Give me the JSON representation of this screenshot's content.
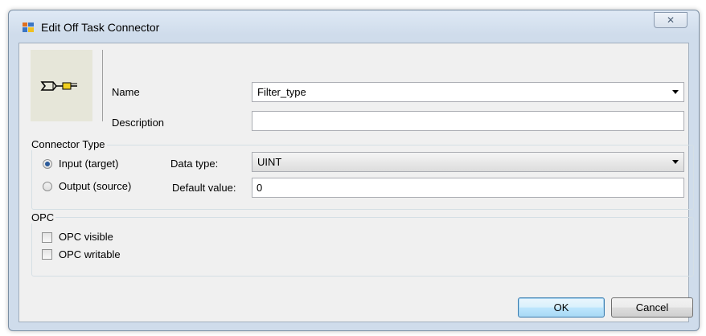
{
  "window": {
    "title": "Edit Off Task Connector",
    "close_glyph": "✕"
  },
  "icons": {
    "app": "dialog-app-icon",
    "connector": "off-task-connector-icon"
  },
  "general": {
    "name_label": "Name",
    "name_value": "Filter_type",
    "description_label": "Description",
    "description_value": ""
  },
  "connector_type": {
    "title": "Connector Type",
    "input_label": "Input (target)",
    "output_label": "Output (source)",
    "selected": "input",
    "data_type_label": "Data type:",
    "data_type_value": "UINT",
    "default_value_label": "Default value:",
    "default_value": "0"
  },
  "opc": {
    "title": "OPC",
    "visible_label": "OPC visible",
    "writable_label": "OPC writable",
    "visible_checked": false,
    "writable_checked": false
  },
  "buttons": {
    "ok": "OK",
    "cancel": "Cancel"
  },
  "colors": {
    "title_bg": "#cfdceb",
    "client_bg": "#f0f0f0",
    "default_button": "#3c7fb1"
  }
}
